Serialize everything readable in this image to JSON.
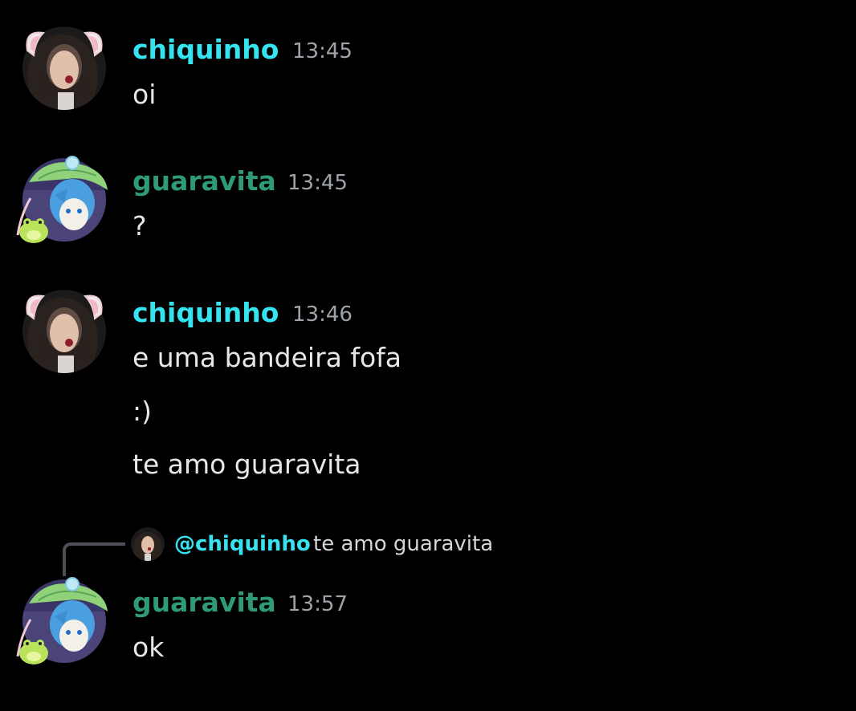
{
  "colors": {
    "background": "#000000",
    "chiquinho": "#35e4f0",
    "guaravita": "#2e9a76",
    "timestamp": "#9ea3aa",
    "text": "#e6e7ea",
    "reply_line": "#4e5058"
  },
  "messages": [
    {
      "author": "chiquinho",
      "time": "13:45",
      "avatar": "cat-ears-girl-avatar",
      "lines": [
        "oi"
      ]
    },
    {
      "author": "guaravita",
      "time": "13:45",
      "avatar": "anime-boy-frog-avatar",
      "lines": [
        "?"
      ]
    },
    {
      "author": "chiquinho",
      "time": "13:46",
      "avatar": "cat-ears-girl-avatar",
      "lines": [
        "e uma bandeira fofa",
        ":)",
        "te amo guaravita"
      ]
    },
    {
      "author": "guaravita",
      "time": "13:57",
      "avatar": "anime-boy-frog-avatar",
      "reply": {
        "mention": "@chiquinho",
        "text": "te amo guaravita"
      },
      "lines": [
        "ok"
      ]
    }
  ]
}
